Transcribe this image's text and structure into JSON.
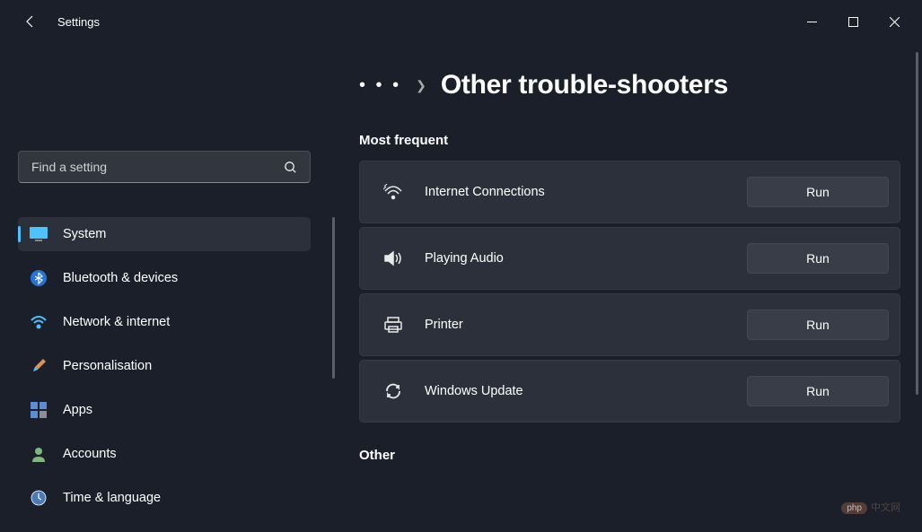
{
  "app": {
    "title": "Settings"
  },
  "search": {
    "placeholder": "Find a setting"
  },
  "sidebar": {
    "items": [
      {
        "label": "System"
      },
      {
        "label": "Bluetooth & devices"
      },
      {
        "label": "Network & internet"
      },
      {
        "label": "Personalisation"
      },
      {
        "label": "Apps"
      },
      {
        "label": "Accounts"
      },
      {
        "label": "Time & language"
      }
    ]
  },
  "breadcrumb": {
    "dots": "• • •",
    "title": "Other trouble-shooters"
  },
  "sections": {
    "most_frequent": "Most frequent",
    "other": "Other"
  },
  "troubleshooters": [
    {
      "label": "Internet Connections",
      "button": "Run"
    },
    {
      "label": "Playing Audio",
      "button": "Run"
    },
    {
      "label": "Printer",
      "button": "Run"
    },
    {
      "label": "Windows Update",
      "button": "Run"
    }
  ],
  "watermark": {
    "badge": "php",
    "text": "中文网"
  }
}
